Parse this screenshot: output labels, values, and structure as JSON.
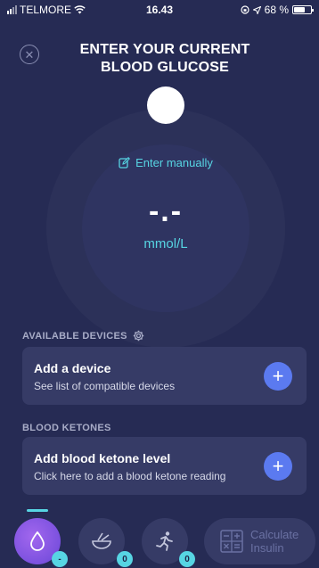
{
  "status_bar": {
    "carrier": "TELMORE",
    "time": "16.43",
    "battery": "68 %",
    "battery_level": 0.68
  },
  "header": {
    "title": "ENTER YOUR CURRENT BLOOD GLUCOSE"
  },
  "dial": {
    "enter_manually": "Enter manually",
    "reading": "-.-",
    "unit": "mmol/L"
  },
  "devices": {
    "section_label": "AVAILABLE DEVICES",
    "card_title": "Add a device",
    "card_subtitle": "See list of compatible devices"
  },
  "ketones": {
    "section_label": "BLOOD KETONES",
    "card_title": "Add blood ketone level",
    "card_subtitle": "Click here to add a blood ketone reading"
  },
  "bottom_nav": {
    "glucose_badge": "-",
    "carbs_badge": "0",
    "exercise_badge": "0",
    "calculate_label_1": "Calculate",
    "calculate_label_2": "Insulin"
  },
  "colors": {
    "background": "#262b54",
    "accent_cyan": "#57d5e3",
    "accent_blue": "#5b7af0",
    "active_purple": "#8a56e6"
  }
}
